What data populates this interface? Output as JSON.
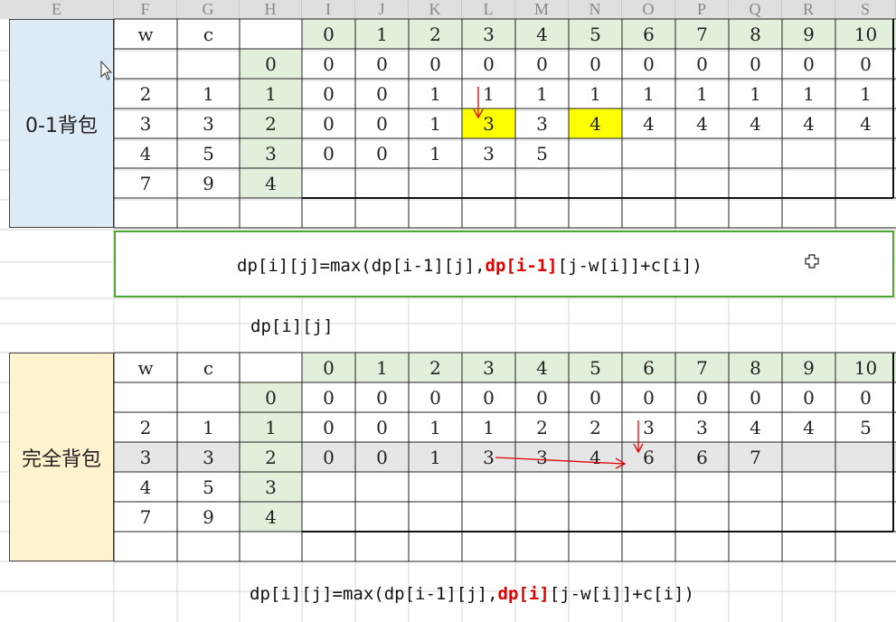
{
  "columns": [
    "E",
    "F",
    "G",
    "H",
    "I",
    "J",
    "K",
    "L",
    "M",
    "N",
    "O",
    "P",
    "Q",
    "R",
    "S"
  ],
  "section1": {
    "title": "0-1背包",
    "header_w": "w",
    "header_c": "c",
    "capacities": [
      "0",
      "1",
      "2",
      "3",
      "4",
      "5",
      "6",
      "7",
      "8",
      "9",
      "10"
    ],
    "items": [
      {
        "w": "",
        "c": "",
        "i": "0",
        "dp": [
          "0",
          "0",
          "0",
          "0",
          "0",
          "0",
          "0",
          "0",
          "0",
          "0",
          "0"
        ]
      },
      {
        "w": "2",
        "c": "1",
        "i": "1",
        "dp": [
          "0",
          "0",
          "1",
          "1",
          "1",
          "1",
          "1",
          "1",
          "1",
          "1",
          "1"
        ]
      },
      {
        "w": "3",
        "c": "3",
        "i": "2",
        "dp": [
          "0",
          "0",
          "1",
          "3",
          "3",
          "4",
          "4",
          "4",
          "4",
          "4",
          "4"
        ]
      },
      {
        "w": "4",
        "c": "5",
        "i": "3",
        "dp": [
          "0",
          "0",
          "1",
          "3",
          "5",
          "",
          "",
          "",
          "",
          "",
          ""
        ]
      },
      {
        "w": "7",
        "c": "9",
        "i": "4",
        "dp": [
          "",
          "",
          "",
          "",
          "",
          "",
          "",
          "",
          "",
          "",
          ""
        ]
      }
    ],
    "highlighted": [
      [
        2,
        3
      ],
      [
        2,
        5
      ]
    ],
    "formula_prefix": "dp[i][j]=max(dp[i-1][j],",
    "formula_red": "dp[i-1]",
    "formula_suffix": "[j-w[i]]+c[i])"
  },
  "dp_label": "dp[i][j]",
  "section2": {
    "title": "完全背包",
    "header_w": "w",
    "header_c": "c",
    "capacities": [
      "0",
      "1",
      "2",
      "3",
      "4",
      "5",
      "6",
      "7",
      "8",
      "9",
      "10"
    ],
    "items": [
      {
        "w": "",
        "c": "",
        "i": "0",
        "dp": [
          "0",
          "0",
          "0",
          "0",
          "0",
          "0",
          "0",
          "0",
          "0",
          "0",
          "0"
        ]
      },
      {
        "w": "2",
        "c": "1",
        "i": "1",
        "dp": [
          "0",
          "0",
          "1",
          "1",
          "2",
          "2",
          "3",
          "3",
          "4",
          "4",
          "5"
        ]
      },
      {
        "w": "3",
        "c": "3",
        "i": "2",
        "dp": [
          "0",
          "0",
          "1",
          "3",
          "3",
          "4",
          "6",
          "6",
          "7",
          "",
          ""
        ]
      },
      {
        "w": "4",
        "c": "5",
        "i": "3",
        "dp": [
          "",
          "",
          "",
          "",
          "",
          "",
          "",
          "",
          "",
          "",
          ""
        ]
      },
      {
        "w": "7",
        "c": "9",
        "i": "4",
        "dp": [
          "",
          "",
          "",
          "",
          "",
          "",
          "",
          "",
          "",
          "",
          ""
        ]
      }
    ],
    "formula_prefix": "dp[i][j]=max(dp[i-1][j],",
    "formula_red": "dp[i]",
    "formula_suffix": "[j-w[i]]+c[i])"
  },
  "colors": {
    "title1_bg": "#ddebf7",
    "title2_bg": "#fff2cc",
    "green_bg": "#e2efda",
    "highlight": "#ffff00",
    "selected_row": "#e6e6e6",
    "formula_border": "#4ea72e",
    "arrow": "#e00000"
  }
}
